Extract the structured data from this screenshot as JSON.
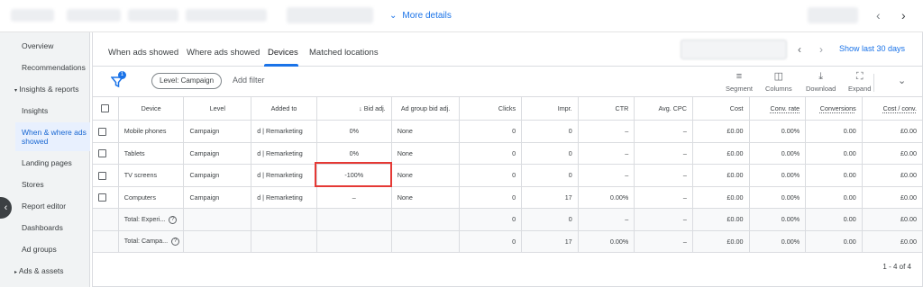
{
  "top": {
    "more_details": "More details"
  },
  "sidebar": {
    "items": [
      {
        "label": "Overview"
      },
      {
        "label": "Recommendations"
      },
      {
        "label": "Insights & reports"
      },
      {
        "label": "Insights"
      },
      {
        "label": "When & where ads showed"
      },
      {
        "label": "Landing pages"
      },
      {
        "label": "Stores"
      },
      {
        "label": "Report editor"
      },
      {
        "label": "Dashboards"
      },
      {
        "label": "Ad groups"
      },
      {
        "label": "Ads & assets"
      }
    ]
  },
  "tabs": [
    {
      "label": "When ads showed"
    },
    {
      "label": "Where ads showed"
    },
    {
      "label": "Devices"
    },
    {
      "label": "Matched locations"
    }
  ],
  "date": {
    "show_last": "Show last 30 days"
  },
  "toolbar": {
    "filter_count": "1",
    "level_chip": "Level: Campaign",
    "add_filter": "Add filter",
    "segment": "Segment",
    "columns": "Columns",
    "download": "Download",
    "expand": "Expand"
  },
  "table": {
    "headers": [
      "Device",
      "Level",
      "Added to",
      "Bid adj.",
      "Ad group bid adj.",
      "Clicks",
      "Impr.",
      "CTR",
      "Avg. CPC",
      "Cost",
      "Conv. rate",
      "Conversions",
      "Cost / conv."
    ],
    "rows": [
      [
        "Mobile phones",
        "Campaign",
        "d | Remarketing",
        "0%",
        "None",
        "0",
        "0",
        "–",
        "–",
        "£0.00",
        "0.00%",
        "0.00",
        "£0.00"
      ],
      [
        "Tablets",
        "Campaign",
        "d | Remarketing",
        "0%",
        "None",
        "0",
        "0",
        "–",
        "–",
        "£0.00",
        "0.00%",
        "0.00",
        "£0.00"
      ],
      [
        "TV screens",
        "Campaign",
        "d | Remarketing",
        "-100%",
        "None",
        "0",
        "0",
        "–",
        "–",
        "£0.00",
        "0.00%",
        "0.00",
        "£0.00"
      ],
      [
        "Computers",
        "Campaign",
        "d | Remarketing",
        "–",
        "None",
        "0",
        "17",
        "0.00%",
        "–",
        "£0.00",
        "0.00%",
        "0.00",
        "£0.00"
      ]
    ],
    "totals": [
      [
        "Total: Experi...",
        "0",
        "0",
        "–",
        "–",
        "£0.00",
        "0.00%",
        "0.00",
        "£0.00"
      ],
      [
        "Total: Campa...",
        "0",
        "17",
        "0.00%",
        "–",
        "£0.00",
        "0.00%",
        "0.00",
        "£0.00"
      ]
    ],
    "pagination": "1 - 4 of 4"
  },
  "colors": {
    "accent": "#1a73e8",
    "highlight_box": "#e53935",
    "sidebar_bg": "#f1f3f4"
  },
  "icons": [
    "filter-icon",
    "segment-icon",
    "columns-icon",
    "download-icon",
    "expand-icon",
    "chevron-down-icon",
    "chevron-left-icon",
    "chevron-right-icon",
    "help-icon",
    "sort-down-arrow-icon"
  ]
}
